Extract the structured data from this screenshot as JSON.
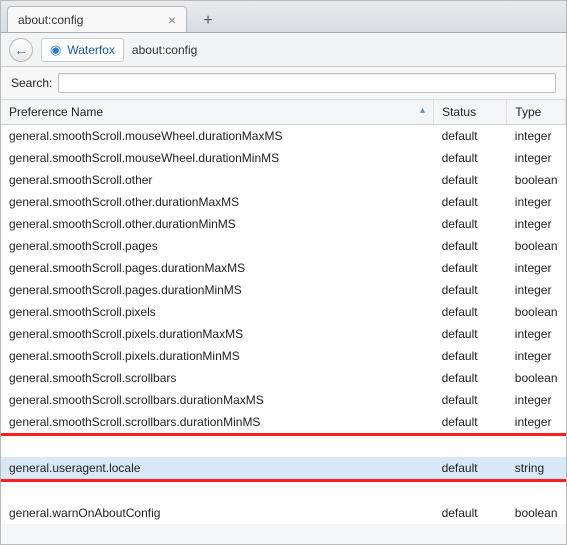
{
  "tab": {
    "title": "about:config",
    "close_glyph": "×",
    "newtab_glyph": "+"
  },
  "nav": {
    "back_glyph": "←",
    "globe_glyph": "◉",
    "brand": "Waterfox",
    "url": "about:config"
  },
  "search": {
    "label": "Search:",
    "value": ""
  },
  "columns": {
    "name": "Preference Name",
    "status": "Status",
    "type": "Type",
    "sort_indicator": "▴"
  },
  "rows": [
    {
      "name": "general.smoothScroll.mouseWheel.durationMaxMS",
      "status": "default",
      "type": "integer"
    },
    {
      "name": "general.smoothScroll.mouseWheel.durationMinMS",
      "status": "default",
      "type": "integer"
    },
    {
      "name": "general.smoothScroll.other",
      "status": "default",
      "type": "boolean"
    },
    {
      "name": "general.smoothScroll.other.durationMaxMS",
      "status": "default",
      "type": "integer"
    },
    {
      "name": "general.smoothScroll.other.durationMinMS",
      "status": "default",
      "type": "integer"
    },
    {
      "name": "general.smoothScroll.pages",
      "status": "default",
      "type": "boolean"
    },
    {
      "name": "general.smoothScroll.pages.durationMaxMS",
      "status": "default",
      "type": "integer"
    },
    {
      "name": "general.smoothScroll.pages.durationMinMS",
      "status": "default",
      "type": "integer"
    },
    {
      "name": "general.smoothScroll.pixels",
      "status": "default",
      "type": "boolean"
    },
    {
      "name": "general.smoothScroll.pixels.durationMaxMS",
      "status": "default",
      "type": "integer"
    },
    {
      "name": "general.smoothScroll.pixels.durationMinMS",
      "status": "default",
      "type": "integer"
    },
    {
      "name": "general.smoothScroll.scrollbars",
      "status": "default",
      "type": "boolean"
    },
    {
      "name": "general.smoothScroll.scrollbars.durationMaxMS",
      "status": "default",
      "type": "integer"
    },
    {
      "name": "general.smoothScroll.scrollbars.durationMinMS",
      "status": "default",
      "type": "integer"
    },
    {
      "name": "general.useragent.locale",
      "status": "default",
      "type": "string",
      "marker": "highlight"
    },
    {
      "name": "general.warnOnAboutConfig",
      "status": "default",
      "type": "boolean"
    }
  ]
}
